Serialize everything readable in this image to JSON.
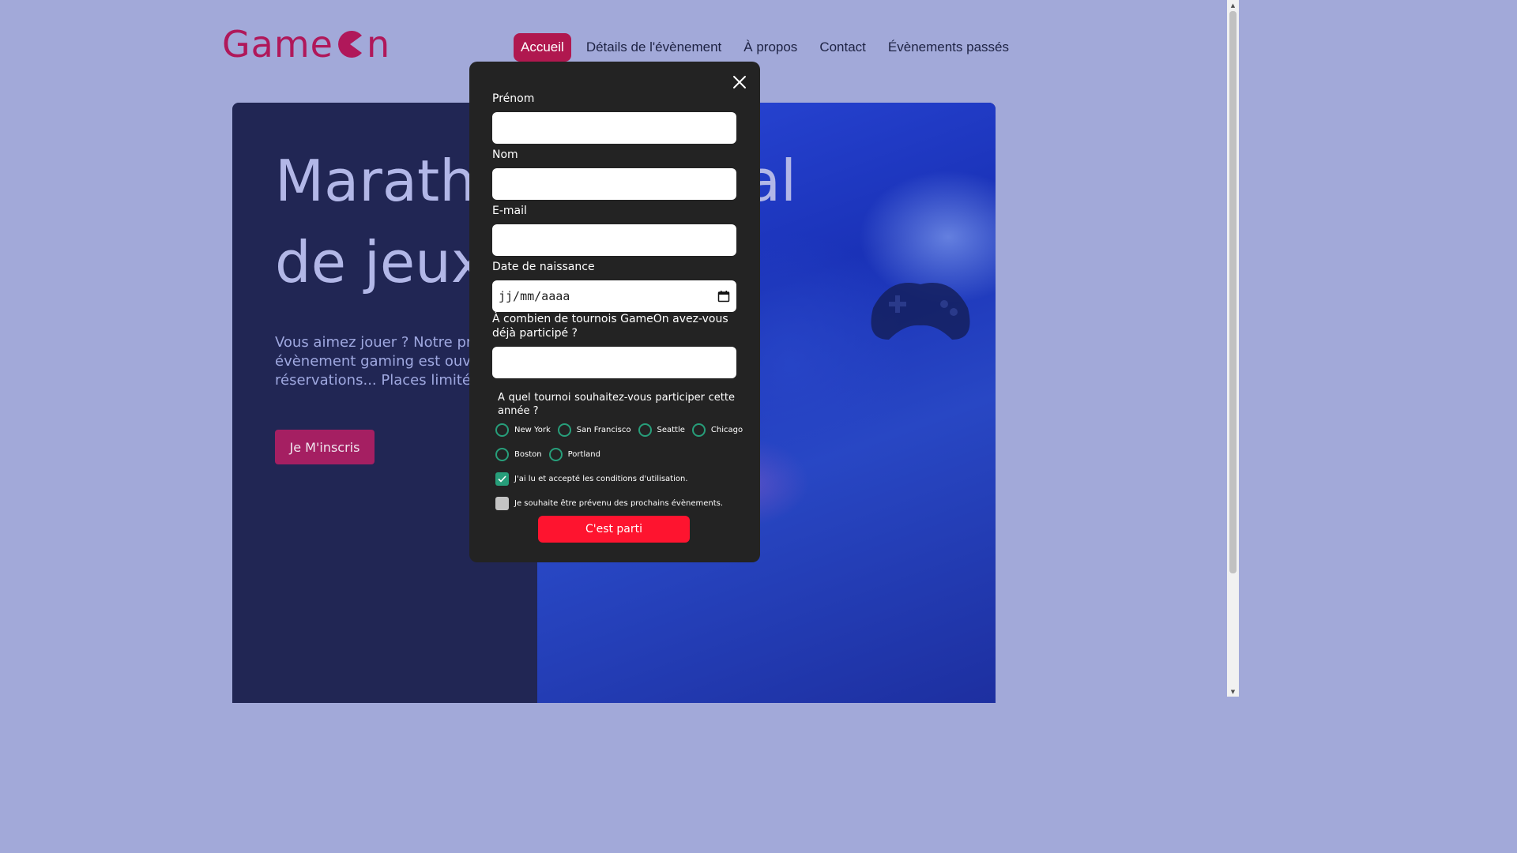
{
  "brand": {
    "logo_text_left": "Game",
    "logo_text_right": "n",
    "color": "#b0185a"
  },
  "nav": {
    "items": [
      {
        "label": "Accueil",
        "active": true
      },
      {
        "label": "Détails de l'évènement",
        "active": false
      },
      {
        "label": "À propos",
        "active": false
      },
      {
        "label": "Contact",
        "active": false
      },
      {
        "label": "Évènements passés",
        "active": false
      }
    ]
  },
  "hero": {
    "title_line1": "Marath",
    "title_line1_tail": "al",
    "title_line2": "de jeux",
    "text_line1": "Vous aimez jouer ? Notre pr",
    "text_line2": "évènement gaming est ouve",
    "text_line3": "réservations... Places limitée",
    "cta_label": "Je M'inscris"
  },
  "modal": {
    "close_icon": "close-icon",
    "first_name_label": "Prénom",
    "first_name_value": "",
    "last_name_label": "Nom",
    "last_name_value": "",
    "email_label": "E-mail",
    "email_value": "",
    "birthdate_label": "Date de naissance",
    "birthdate_placeholder": "jj/mm/aaaa",
    "tournaments_count_label": "À combien de tournois GameOn avez-vous déjà participé ?",
    "tournaments_count_value": "",
    "location_question": "A quel tournoi souhaitez-vous participer cette année ?",
    "locations": [
      "New York",
      "San Francisco",
      "Seattle",
      "Chicago",
      "Boston",
      "Portland"
    ],
    "terms_label": "J'ai lu et accepté les conditions d'utilisation.",
    "terms_checked": true,
    "newsletter_label": "Je souhaite être prévenu des prochains évènements.",
    "newsletter_checked": false,
    "submit_label": "C'est parti"
  },
  "colors": {
    "page_bg": "#a2a9d9",
    "hero_bg": "#212654",
    "modal_bg": "#232323",
    "accent_green": "#279e7a",
    "submit_red": "#fe142f",
    "nav_active": "#b0184f"
  }
}
